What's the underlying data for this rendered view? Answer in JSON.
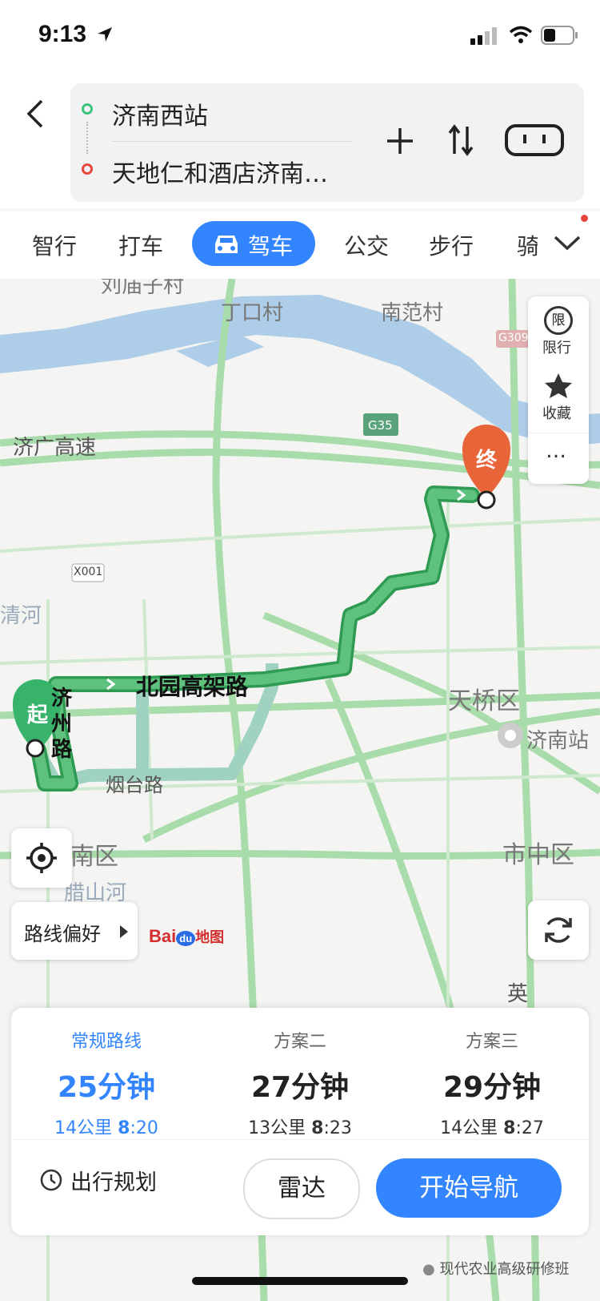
{
  "status_bar": {
    "time": "9:13"
  },
  "route": {
    "origin": "济南西站",
    "destination": "天地仁和酒店济南…"
  },
  "modes": [
    {
      "label": "智行"
    },
    {
      "label": "打车"
    },
    {
      "label": "驾车",
      "active": true
    },
    {
      "label": "公交"
    },
    {
      "label": "步行"
    },
    {
      "label": "骑"
    }
  ],
  "map": {
    "labels": {
      "liumiao": "刘庙子村",
      "dingkou": "丁口村",
      "nanfan": "南范村",
      "jiguang": "济广高速",
      "qinghe": "清河",
      "tianqiao": "天桥区",
      "jinanzhan": "济南站",
      "shizhong": "市中区",
      "nanqu": "南区",
      "lashan": "腊山河",
      "beiyuan": "北园高架路",
      "yantai": "烟台路",
      "jizhou": "济州路",
      "ying": "英",
      "g35": "G35",
      "g309": "G309",
      "x001": "X001"
    },
    "markers": {
      "start": "起",
      "end": "终"
    },
    "side_controls": {
      "restrict": "限行",
      "restrict_badge": "限",
      "favorite": "收藏",
      "more": "…"
    },
    "route_pref": "路线偏好",
    "brand": {
      "bai": "Bai",
      "du": "du",
      "ditu": "地图"
    },
    "route_color": "#4fbf73"
  },
  "options": [
    {
      "label": "常规路线",
      "duration": "25分钟",
      "distance": "14公里",
      "lights": "20",
      "active": true
    },
    {
      "label": "方案二",
      "duration": "27分钟",
      "distance": "13公里",
      "lights": "23"
    },
    {
      "label": "方案三",
      "duration": "29分钟",
      "distance": "14公里",
      "lights": "27"
    }
  ],
  "actions": {
    "plan": "出行规划",
    "radar": "雷达",
    "navigate": "开始导航"
  },
  "watermark": "现代农业高级研修班"
}
